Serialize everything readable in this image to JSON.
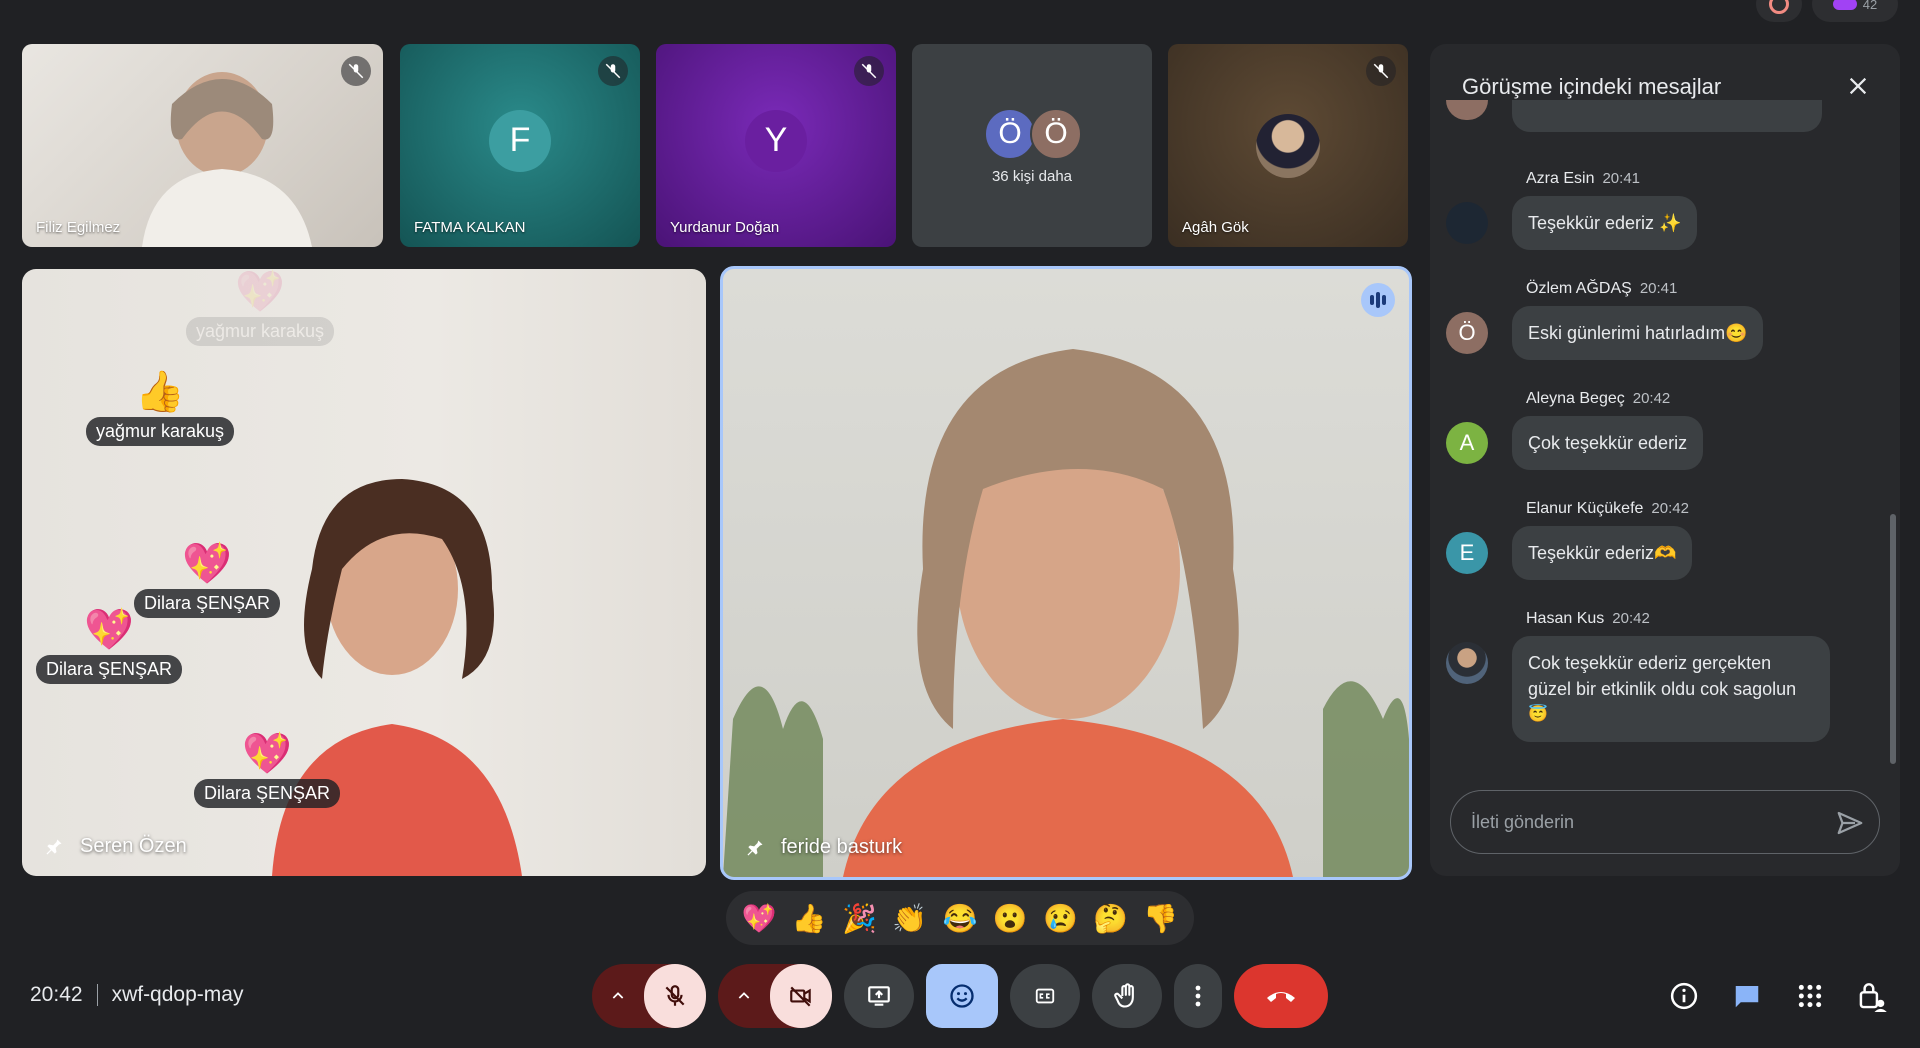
{
  "top_badges": {
    "participant_count": "42"
  },
  "tiles": [
    {
      "name": "Filiz Egilmez",
      "type": "video"
    },
    {
      "name": "FATMA KALKAN",
      "initial": "F",
      "bg": "#1f6e6e",
      "avatar_color": "#3c9ea1"
    },
    {
      "name": "Yurdanur Doğan",
      "initial": "Y",
      "bg": "#5a1a86",
      "avatar_color": "#6a1fa0"
    },
    {
      "more_text": "36 kişi daha",
      "initials": [
        "Ö",
        "Ö"
      ]
    },
    {
      "name": "Agâh Gök",
      "type": "avatar-photo"
    }
  ],
  "main_speakers": [
    {
      "name": "Seren Özen"
    },
    {
      "name": "feride basturk"
    }
  ],
  "floating_reactions": [
    {
      "emoji": "💖",
      "name": "yağmur karakuş",
      "faded": true
    },
    {
      "emoji": "👍",
      "name": "yağmur karakuş"
    },
    {
      "emoji": "💖",
      "name": "Dilara ŞENŞAR"
    },
    {
      "emoji": "💖",
      "name": "Dilara ŞENŞAR"
    },
    {
      "emoji": "💖",
      "name": "Dilara ŞENŞAR"
    }
  ],
  "chat": {
    "title": "Görüşme içindeki mesajlar",
    "messages": [
      {
        "author": "Azra Esin",
        "time": "20:41",
        "text": "Teşekkür ederiz ✨",
        "avatar": "",
        "avatar_color": "#1d2733"
      },
      {
        "author": "Özlem AĞDAŞ",
        "time": "20:41",
        "text": "Eski günlerimi hatırladım😊",
        "avatar": "Ö",
        "avatar_color": "#8d6e63"
      },
      {
        "author": "Aleyna Begeç",
        "time": "20:42",
        "text": "Çok teşekkür ederiz",
        "avatar": "A",
        "avatar_color": "#7cb342"
      },
      {
        "author": "Elanur Küçükefe",
        "time": "20:42",
        "text": "Teşekkür ederiz🫶",
        "avatar": "E",
        "avatar_color": "#3a96a8"
      },
      {
        "author": "Hasan Kus",
        "time": "20:42",
        "text_lines": [
          "Cok teşekkür ederiz gerçekten",
          "güzel bir etkinlik oldu cok sagolun",
          "😇"
        ],
        "avatar": "",
        "avatar_color": "#4a4f57"
      }
    ],
    "input_placeholder": "İleti gönderin"
  },
  "reaction_bar": [
    "💖",
    "👍",
    "🎉",
    "👏",
    "😂",
    "😮",
    "😢",
    "🤔",
    "👎"
  ],
  "meeting": {
    "time": "20:42",
    "code": "xwf-qdop-may"
  },
  "colors": {
    "accent_blue": "#a8c7fa",
    "hangup_red": "#dc362e",
    "muted_red": "#5c1a1a"
  }
}
